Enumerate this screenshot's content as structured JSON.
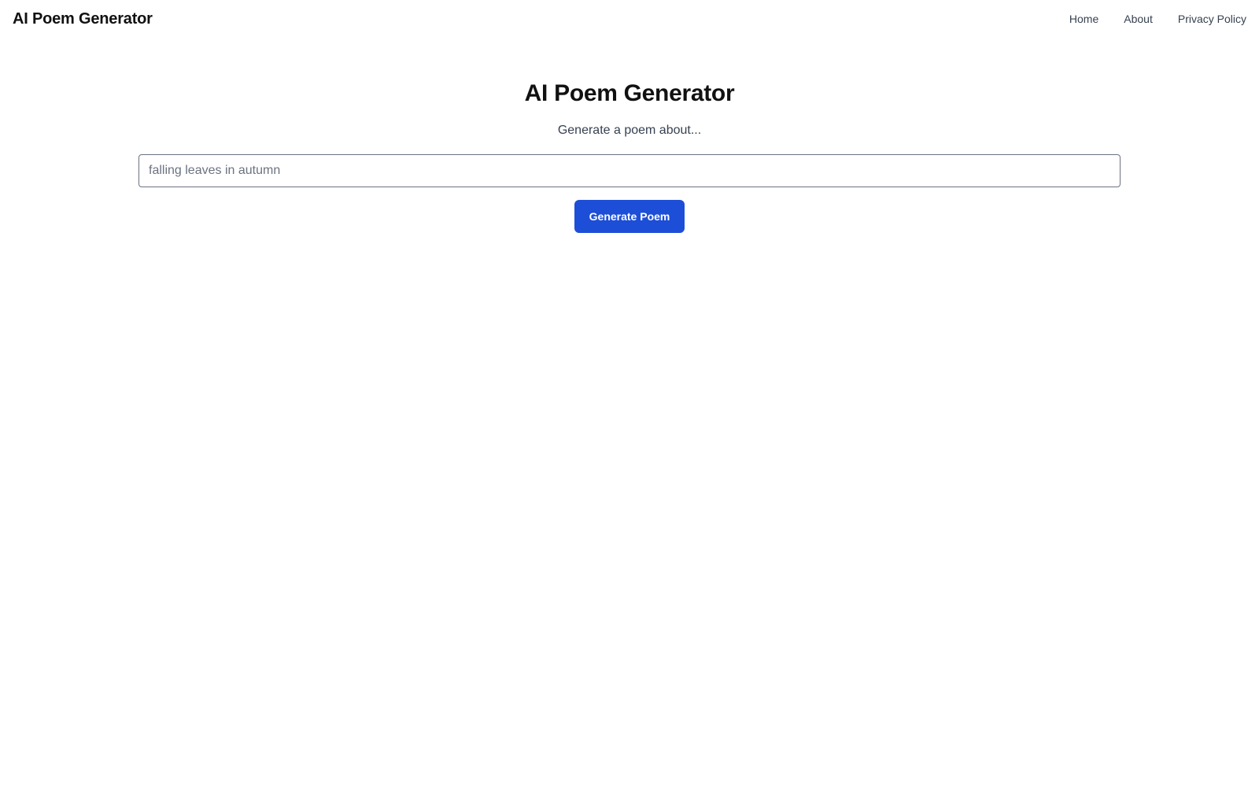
{
  "header": {
    "brand": "AI Poem Generator",
    "nav": [
      {
        "label": "Home"
      },
      {
        "label": "About"
      },
      {
        "label": "Privacy Policy"
      }
    ]
  },
  "main": {
    "title": "AI Poem Generator",
    "subtitle": "Generate a poem about...",
    "topic_input": {
      "value": "",
      "placeholder": "falling leaves in autumn"
    },
    "generate_label": "Generate Poem"
  },
  "colors": {
    "accent": "#1d4ed8",
    "text": "#111111",
    "muted": "#374151"
  }
}
